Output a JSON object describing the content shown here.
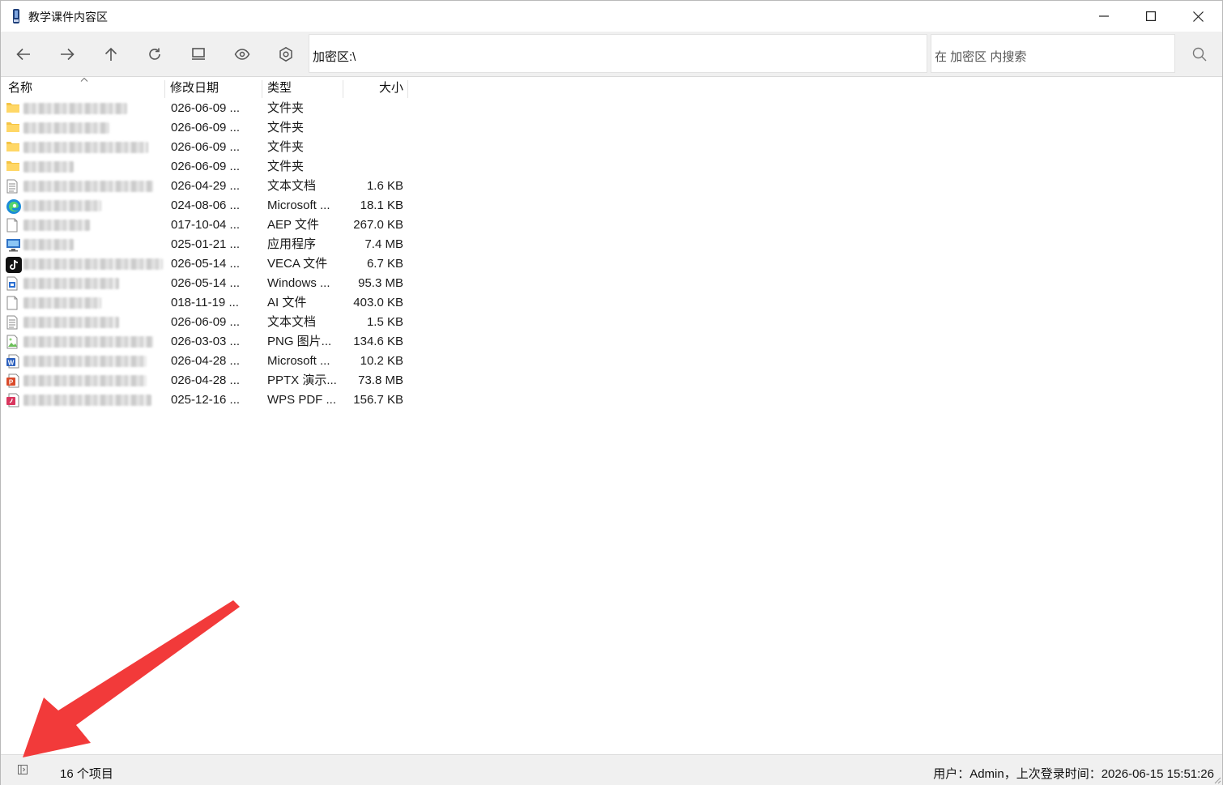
{
  "window": {
    "title": "教学课件内容区"
  },
  "toolbar": {
    "address": "加密区:\\",
    "search_placeholder": "在 加密区 内搜索",
    "buttons": [
      "back-icon",
      "forward-icon",
      "up-icon",
      "refresh-icon",
      "monitor-icon",
      "eye-icon",
      "settings-icon"
    ]
  },
  "columns": {
    "name": "名称",
    "date": "修改日期",
    "type": "类型",
    "size": "大小"
  },
  "files": [
    {
      "icon": "folder-icon",
      "name": "",
      "date": "026-06-09 ...",
      "type": "文件夹",
      "size": ""
    },
    {
      "icon": "folder-icon",
      "name": "",
      "date": "026-06-09 ...",
      "type": "文件夹",
      "size": ""
    },
    {
      "icon": "folder-icon",
      "name": "",
      "date": "026-06-09 ...",
      "type": "文件夹",
      "size": ""
    },
    {
      "icon": "folder-icon",
      "name": "",
      "date": "026-06-09 ...",
      "type": "文件夹",
      "size": ""
    },
    {
      "icon": "text-document-icon",
      "name": "",
      "date": "026-04-29 ...",
      "type": "文本文档",
      "size": "1.6 KB"
    },
    {
      "icon": "edge-icon",
      "name": "",
      "date": "024-08-06 ...",
      "type": "Microsoft ...",
      "size": "18.1 KB"
    },
    {
      "icon": "blank-file-icon",
      "name": "",
      "date": "017-10-04 ...",
      "type": "AEP 文件",
      "size": "267.0 KB"
    },
    {
      "icon": "application-icon",
      "name": "",
      "date": "025-01-21 ...",
      "type": "应用程序",
      "size": "7.4 MB"
    },
    {
      "icon": "tiktok-icon",
      "name": "",
      "date": "026-05-14 ...",
      "type": "VECA 文件",
      "size": "6.7 KB"
    },
    {
      "icon": "installer-icon",
      "name": "",
      "date": "026-05-14 ...",
      "type": "Windows ...",
      "size": "95.3 MB"
    },
    {
      "icon": "blank-file-icon",
      "name": "",
      "date": "018-11-19 ...",
      "type": "AI 文件",
      "size": "403.0 KB"
    },
    {
      "icon": "text-document-icon",
      "name": "",
      "date": "026-06-09 ...",
      "type": "文本文档",
      "size": "1.5 KB"
    },
    {
      "icon": "png-image-icon",
      "name": "",
      "date": "026-03-03 ...",
      "type": "PNG 图片...",
      "size": "134.6 KB"
    },
    {
      "icon": "word-icon",
      "name": "",
      "date": "026-04-28 ...",
      "type": "Microsoft ...",
      "size": "10.2 KB"
    },
    {
      "icon": "powerpoint-icon",
      "name": "",
      "date": "026-04-28 ...",
      "type": "PPTX 演示...",
      "size": "73.8 MB"
    },
    {
      "icon": "wps-pdf-icon",
      "name": "",
      "date": "025-12-16 ...",
      "type": "WPS PDF ...",
      "size": "156.7 KB"
    }
  ],
  "status": {
    "count": "16 个项目",
    "user_info": "用户：Admin，上次登录时间：2026-06-15  15:51:26"
  },
  "colors": {
    "toolbar_bg": "#f0f0f0",
    "annotation_arrow": "#f23a3a",
    "folder": "#f5c443"
  }
}
